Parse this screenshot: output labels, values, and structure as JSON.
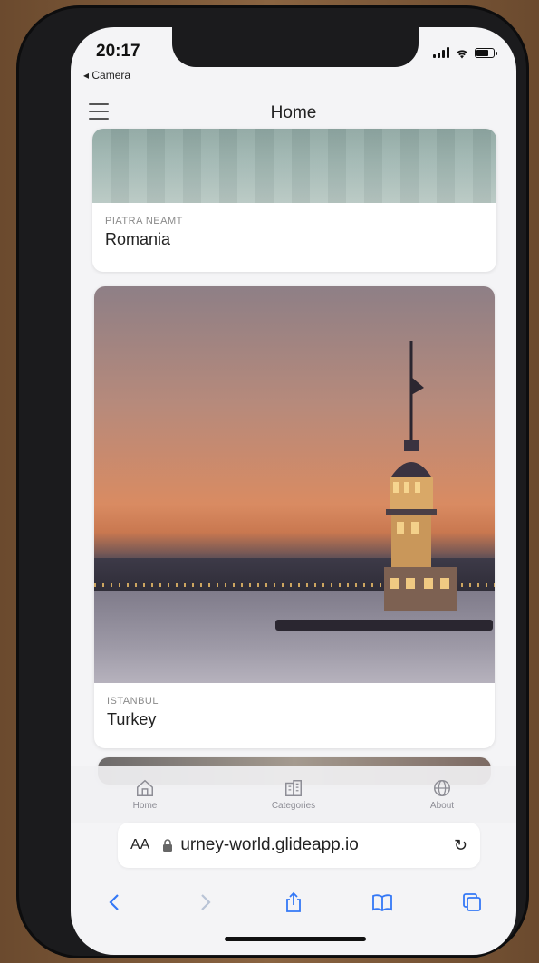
{
  "status_bar": {
    "time": "20:17",
    "back_label": "◂ Camera"
  },
  "header": {
    "title": "Home"
  },
  "cards": [
    {
      "subtitle": "PIATRA NEAMT",
      "title": "Romania"
    },
    {
      "subtitle": "ISTANBUL",
      "title": "Turkey"
    }
  ],
  "tabs": [
    {
      "label": "Home",
      "icon": "home-icon",
      "active": true
    },
    {
      "label": "Categories",
      "icon": "buildings-icon",
      "active": false
    },
    {
      "label": "About",
      "icon": "globe-icon",
      "active": false
    }
  ],
  "browser": {
    "aa_label": "AA",
    "url": "urney-world.glideapp.io",
    "reload_glyph": "↻"
  },
  "colors": {
    "accent": "#3478f6",
    "tab_icon": "#8d8d95"
  }
}
